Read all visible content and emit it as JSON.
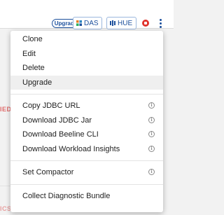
{
  "header": {
    "upgrade_badge": "Upgrade",
    "services": [
      {
        "label": "DAS",
        "icon": "das-icon"
      },
      {
        "label": "HUE",
        "icon": "hue-icon"
      }
    ],
    "stop_icon": "stop-icon",
    "more_icon": "kebab-menu-icon"
  },
  "background": {
    "status_text_1": "IED",
    "status_text_2": "ICS"
  },
  "menu": {
    "group1": [
      {
        "label": "Clone"
      },
      {
        "label": "Edit"
      },
      {
        "label": "Delete"
      },
      {
        "label": "Upgrade",
        "highlighted": true
      }
    ],
    "group2": [
      {
        "label": "Copy JDBC URL",
        "info": true
      },
      {
        "label": "Download JDBC Jar",
        "info": true
      },
      {
        "label": "Download Beeline CLI",
        "info": true
      },
      {
        "label": "Download Workload Insights",
        "info": true
      }
    ],
    "group3": [
      {
        "label": "Set Compactor",
        "info": true
      }
    ],
    "group4": [
      {
        "label": "Collect Diagnostic Bundle"
      }
    ],
    "info_glyph": "i"
  },
  "colors": {
    "accent": "#1b4f9c",
    "danger": "#e0322c",
    "menu_highlight": "#efefef"
  }
}
